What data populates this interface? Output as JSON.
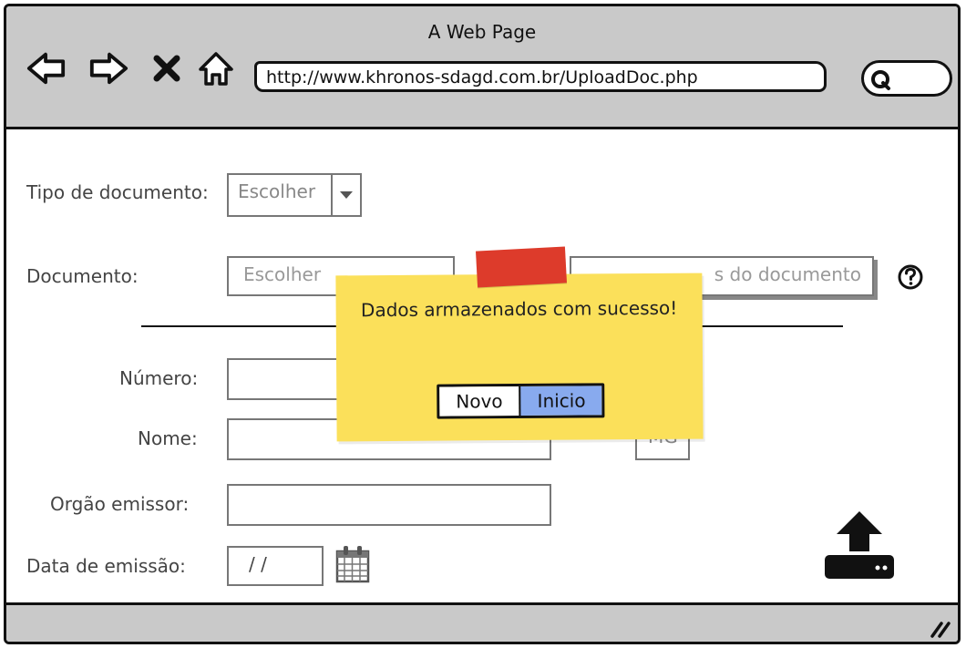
{
  "window": {
    "title": "A Web Page",
    "url": "http://www.khronos-sdagd.com.br/UploadDoc.php"
  },
  "form": {
    "tipo_label": "Tipo de documento:",
    "tipo_select": "Escolher",
    "documento_label": "Documento:",
    "documento_placeholder": "Escolher",
    "extrair_placeholder": "s do documento",
    "numero_label": "Número:",
    "nome_label": "Nome:",
    "uf_value": "MG",
    "orgao_label": "Orgão emissor:",
    "data_label": "Data de emissão:",
    "data_value": "/ /"
  },
  "popup": {
    "message": "Dados armazenados com sucesso!",
    "buttons": [
      "Novo",
      "Inicio"
    ],
    "active_button": "Inicio",
    "accent_color": "#88aaee",
    "note_color": "#fbe05a",
    "tape_color": "#dd3b2b"
  },
  "icons": [
    "back-arrow-icon",
    "forward-arrow-icon",
    "close-icon",
    "home-icon",
    "search-icon",
    "chevron-down-icon",
    "help-icon",
    "calendar-icon",
    "upload-icon",
    "resize-grip-icon"
  ]
}
